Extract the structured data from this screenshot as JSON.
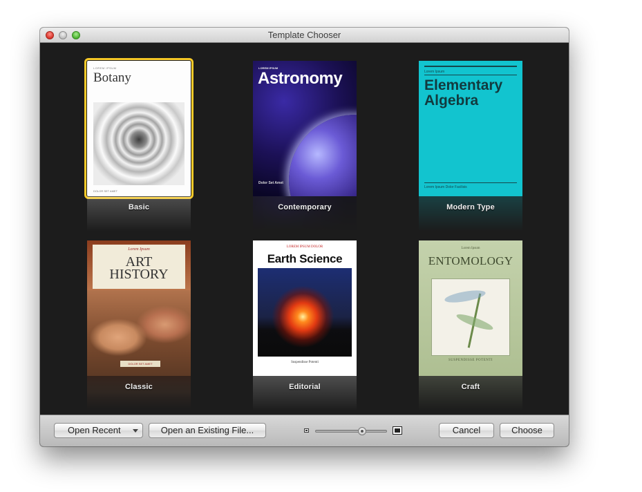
{
  "window": {
    "title": "Template Chooser"
  },
  "templates": [
    {
      "name": "Basic",
      "selected": true,
      "cover": {
        "kicker": "LOREM IPSUM",
        "title": "Botany",
        "footer": "DOLOR SET AMET"
      }
    },
    {
      "name": "Contemporary",
      "selected": false,
      "cover": {
        "kicker": "LOREM IPSUM",
        "title": "Astronomy",
        "footer": "Dolor Set Amet"
      }
    },
    {
      "name": "Modern Type",
      "selected": false,
      "cover": {
        "kicker": "Lorem Ipsum",
        "title": "Elementary Algebra",
        "footer": "Lorem Ipsum Dolor Facilisis"
      }
    },
    {
      "name": "Classic",
      "selected": false,
      "cover": {
        "kicker": "Lorem Ipsum",
        "title": "ART HISTORY",
        "footer": "DOLOR SET AMET"
      }
    },
    {
      "name": "Editorial",
      "selected": false,
      "cover": {
        "kicker": "LOREM IPSUM DOLOR",
        "title": "Earth Science",
        "footer": "Suspendisse Potenti"
      }
    },
    {
      "name": "Craft",
      "selected": false,
      "cover": {
        "kicker": "Lorem Ipsum",
        "title": "ENTOMOLOGY",
        "footer": "SUSPENDISSE POTENTI"
      }
    }
  ],
  "bottombar": {
    "open_recent_label": "Open Recent",
    "open_existing_label": "Open an Existing File...",
    "cancel_label": "Cancel",
    "choose_label": "Choose",
    "zoom_level": 0.65
  },
  "colors": {
    "selection": "#f7c928",
    "content_background": "#1c1c1c"
  },
  "icons": [
    "close-button-icon",
    "minimize-button-icon",
    "zoom-button-icon",
    "zoom-small-icon",
    "zoom-large-icon",
    "dropdown-arrow-icon"
  ]
}
